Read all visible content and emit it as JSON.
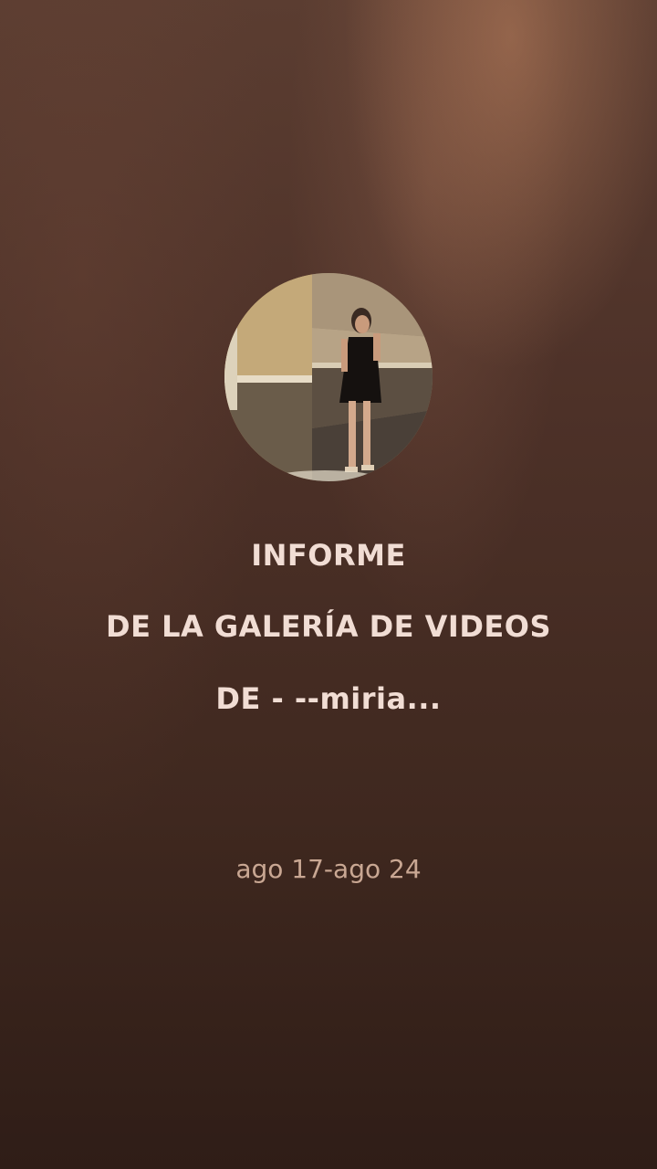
{
  "report": {
    "title_line1": "INFORME",
    "title_line2": "DE LA GALERÍA DE VIDEOS",
    "title_line3": "DE - --miria...",
    "date_range": "ago 17-ago 24"
  },
  "colors": {
    "background_top": "#5b3d31",
    "background_bottom": "#2f1d17",
    "title_text": "#f1ddd4",
    "date_text": "#c9a793"
  }
}
